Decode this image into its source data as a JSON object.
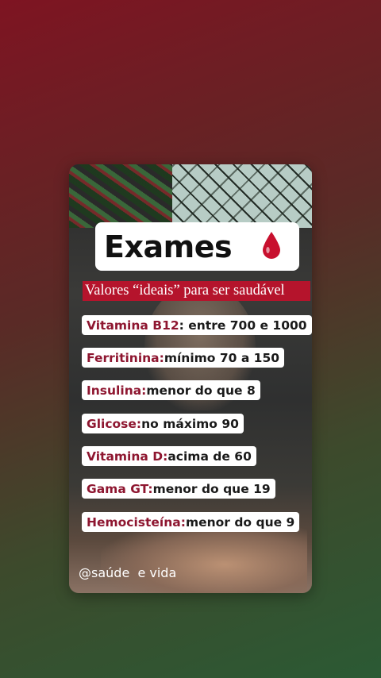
{
  "post": {
    "title": "Exames",
    "title_icon": "blood-drop-icon",
    "subtitle": "Valores “ideais” para ser saudável",
    "watermark": "@saúde  e vida",
    "items": [
      {
        "label": "Vitamina B12",
        "value": " : entre 700 e 1000"
      },
      {
        "label": "Ferritinina:",
        "value": " mínimo 70 a 150"
      },
      {
        "label": "Insulina:",
        "value": " menor do que 8"
      },
      {
        "label": "Glicose:",
        "value": " no máximo 90"
      },
      {
        "label": "Vitamina D:",
        "value": " acima de 60"
      },
      {
        "label": "Gama GT:",
        "value": " menor do que 19"
      },
      {
        "label": "Hemocisteína:",
        "value": " menor do que 9"
      }
    ]
  },
  "colors": {
    "accent_red": "#b5142c",
    "label_red": "#8e1630"
  }
}
